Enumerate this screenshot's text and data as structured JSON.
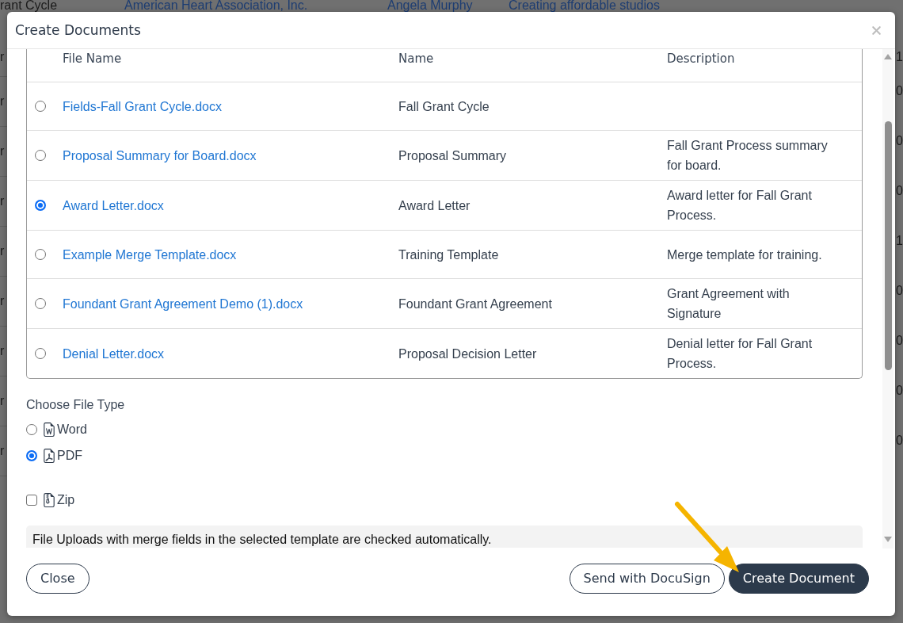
{
  "backdrop": {
    "top_row": [
      {
        "text": "rant Cycle",
        "kind": "text"
      },
      {
        "text": "American Heart Association, Inc.",
        "kind": "link"
      },
      {
        "text": "Angela Murphy",
        "kind": "link"
      },
      {
        "text": "Creating affordable studios",
        "kind": "link"
      }
    ],
    "left_edge": [
      "r",
      "r",
      "r",
      "r",
      "r",
      "r",
      "r",
      "r",
      "r"
    ],
    "right_edge": [
      "1",
      "0",
      "0",
      "0",
      "1",
      "0",
      "0",
      "0",
      "0"
    ]
  },
  "dialog": {
    "title": "Create Documents",
    "table": {
      "columns": [
        "File Name",
        "Name",
        "Description"
      ],
      "rows": [
        {
          "file_name": "Fields-Fall Grant Cycle.docx",
          "name": "Fall Grant Cycle",
          "selected": false
        },
        {
          "file_name": "Proposal Summary for Board.docx",
          "name": "Proposal Summary",
          "description": "Fall Grant Process summary for board.",
          "selected": false
        },
        {
          "file_name": "Award Letter.docx",
          "name": "Award Letter",
          "description": "Award letter for Fall Grant Process.",
          "selected": true
        },
        {
          "file_name": "Example Merge Template.docx",
          "name": "Training Template",
          "description": "Merge template for training.",
          "selected": false
        },
        {
          "file_name": "Foundant Grant Agreement Demo (1).docx",
          "name": "Foundant Grant Agreement",
          "description": "Grant Agreement with Signature",
          "selected": false
        },
        {
          "file_name": "Denial Letter.docx",
          "name": "Proposal Decision Letter",
          "description": "Denial letter for Fall Grant Process.",
          "selected": false
        }
      ]
    },
    "file_type": {
      "label": "Choose File Type",
      "formats": [
        {
          "label": "Word",
          "selected": false
        },
        {
          "label": "PDF",
          "selected": true
        }
      ],
      "zip": {
        "label": "Zip",
        "checked": false
      }
    },
    "note": "File Uploads with merge fields in the selected template are checked automatically.",
    "footer": {
      "left_buttons": [
        {
          "label": "Close",
          "kind": "outline"
        }
      ],
      "right_buttons": [
        {
          "label": "Send with DocuSign",
          "kind": "outline"
        },
        {
          "label": "Create Document",
          "kind": "primary"
        }
      ]
    }
  }
}
